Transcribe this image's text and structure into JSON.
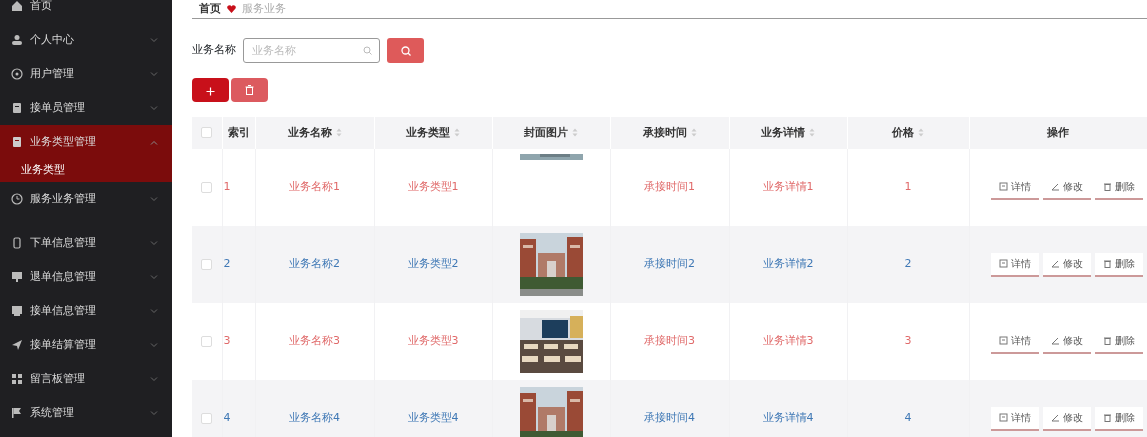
{
  "sidebar": {
    "items": [
      {
        "label": "首页",
        "selected": false,
        "has_caret": false
      },
      {
        "label": "个人中心",
        "expanded": false,
        "selected": false,
        "has_caret": true
      },
      {
        "label": "用户管理",
        "expanded": false,
        "selected": false,
        "has_caret": true
      },
      {
        "label": "接单员管理",
        "expanded": false,
        "selected": false,
        "has_caret": true
      },
      {
        "label": "业务类型管理",
        "expanded": true,
        "selected": true,
        "has_caret": true,
        "children": [
          {
            "label": "业务类型"
          }
        ]
      },
      {
        "label": "服务业务管理",
        "expanded": false,
        "selected": false,
        "has_caret": true
      },
      {
        "label": "下单信息管理",
        "expanded": false,
        "selected": false,
        "has_caret": true
      },
      {
        "label": "退单信息管理",
        "expanded": false,
        "selected": false,
        "has_caret": true
      },
      {
        "label": "接单信息管理",
        "expanded": false,
        "selected": false,
        "has_caret": true
      },
      {
        "label": "接单结算管理",
        "expanded": false,
        "selected": false,
        "has_caret": true
      },
      {
        "label": "留言板管理",
        "expanded": false,
        "selected": false,
        "has_caret": true
      },
      {
        "label": "系统管理",
        "expanded": false,
        "selected": false,
        "has_caret": true
      }
    ]
  },
  "breadcrumb": [
    "首页",
    "服务业务"
  ],
  "search": {
    "label": "业务名称",
    "placeholder": "业务名称"
  },
  "table": {
    "select_all": {
      "checked": false
    },
    "columns": [
      {
        "label": "索引",
        "kind": "plain"
      },
      {
        "label": "业务名称",
        "kind": "sortable"
      },
      {
        "label": "业务类型",
        "kind": "sortable"
      },
      {
        "label": "封面图片",
        "kind": "sortable"
      },
      {
        "label": "承接时间",
        "kind": "sortable"
      },
      {
        "label": "业务详情",
        "kind": "sortable"
      },
      {
        "label": "价格",
        "kind": "sortable"
      },
      {
        "label": "操作",
        "kind": "plain"
      }
    ],
    "rows": [
      {
        "checked": false,
        "index": "1",
        "name": "业务名称1",
        "type": "业务类型1",
        "cover": {
          "kind": "picture",
          "loaded": false
        },
        "time": "承接时间1",
        "detail": "业务详情1",
        "price": "1",
        "actions": [
          "详情",
          "修改",
          "删除"
        ]
      },
      {
        "checked": false,
        "index": "2",
        "name": "业务名称2",
        "type": "业务类型2",
        "cover": {
          "kind": "picture",
          "loaded": true
        },
        "time": "承接时间2",
        "detail": "业务详情2",
        "price": "2",
        "actions": [
          "详情",
          "修改",
          "删除"
        ]
      },
      {
        "checked": false,
        "index": "3",
        "name": "业务名称3",
        "type": "业务类型3",
        "cover": {
          "kind": "picture",
          "loaded": true
        },
        "time": "承接时间3",
        "detail": "业务详情3",
        "price": "3",
        "actions": [
          "详情",
          "修改",
          "删除"
        ]
      },
      {
        "checked": false,
        "index": "4",
        "name": "业务名称4",
        "type": "业务类型4",
        "cover": {
          "kind": "picture",
          "loaded": true
        },
        "time": "承接时间4",
        "detail": "业务详情4",
        "price": "4",
        "actions": [
          "详情",
          "修改",
          "删除"
        ]
      }
    ]
  }
}
